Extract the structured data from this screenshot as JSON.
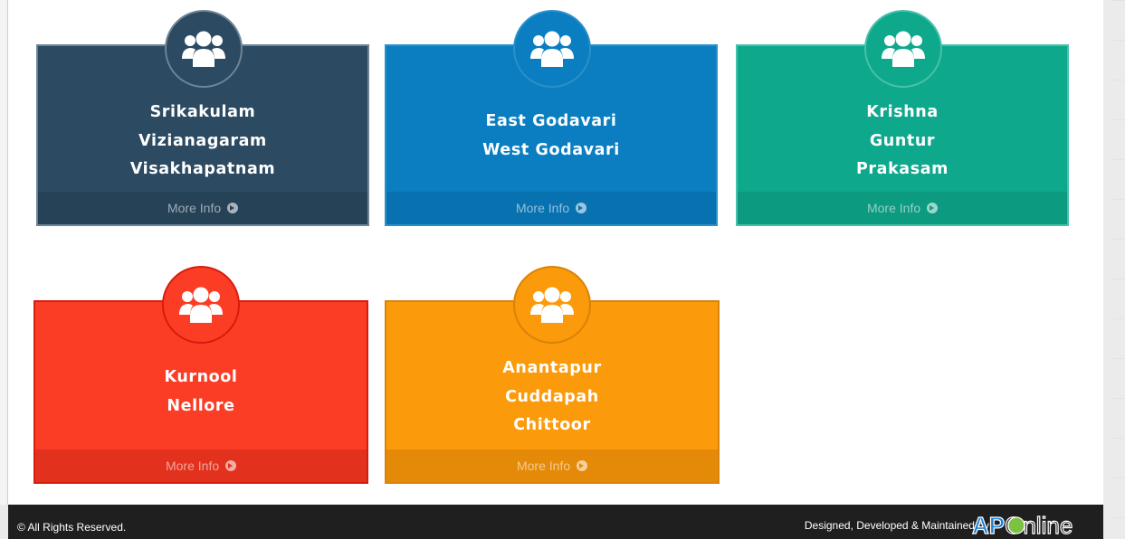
{
  "tiles": [
    {
      "names": [
        "Srikakulam",
        "Vizianagaram",
        "Visakhapatnam"
      ],
      "more": "More Info",
      "icon": "users-icon"
    },
    {
      "names": [
        "East Godavari",
        "West Godavari"
      ],
      "more": "More Info",
      "icon": "users-icon"
    },
    {
      "names": [
        "Krishna",
        "Guntur",
        "Prakasam"
      ],
      "more": "More Info",
      "icon": "users-icon"
    },
    {
      "names": [
        "Kurnool",
        "Nellore"
      ],
      "more": "More Info",
      "icon": "users-icon"
    },
    {
      "names": [
        "Anantapur",
        "Cuddapah",
        "Chittoor"
      ],
      "more": "More Info",
      "icon": "users-icon"
    }
  ],
  "footer": {
    "copyright": "© All Rights Reserved.",
    "credit": "Designed, Developed & Maintained by",
    "logo": "APOnline"
  },
  "colors": {
    "navy": "#2c4a61",
    "blue": "#0a7ec1",
    "teal": "#0ea88c",
    "red": "#fb3d25",
    "orange": "#fb9a0a"
  }
}
